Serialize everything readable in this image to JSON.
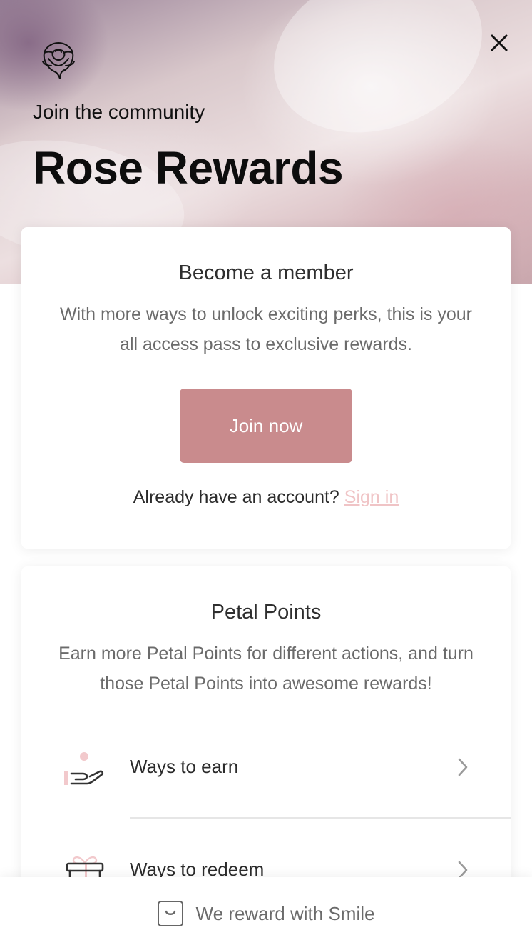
{
  "hero": {
    "subtitle": "Join the community",
    "title": "Rose Rewards",
    "logo_icon": "rose-icon",
    "close_icon": "close-icon"
  },
  "member_card": {
    "title": "Become a member",
    "description": "With more ways to unlock exciting perks, this is your all access pass to exclusive rewards.",
    "join_label": "Join now",
    "signin_prompt": "Already have an account?",
    "signin_label": "Sign in"
  },
  "points_card": {
    "title": "Petal Points",
    "description": "Earn more Petal Points for different actions, and turn those Petal Points into awesome rewards!",
    "items": [
      {
        "label": "Ways to earn",
        "icon": "hand-coin-icon"
      },
      {
        "label": "Ways to redeem",
        "icon": "gift-icon"
      }
    ]
  },
  "footer": {
    "text": "We reward with Smile",
    "icon": "smile-logo-icon"
  },
  "colors": {
    "accent": "#c98b8d",
    "link": "#f0c4c6",
    "icon_accent": "#f2c9cc"
  }
}
